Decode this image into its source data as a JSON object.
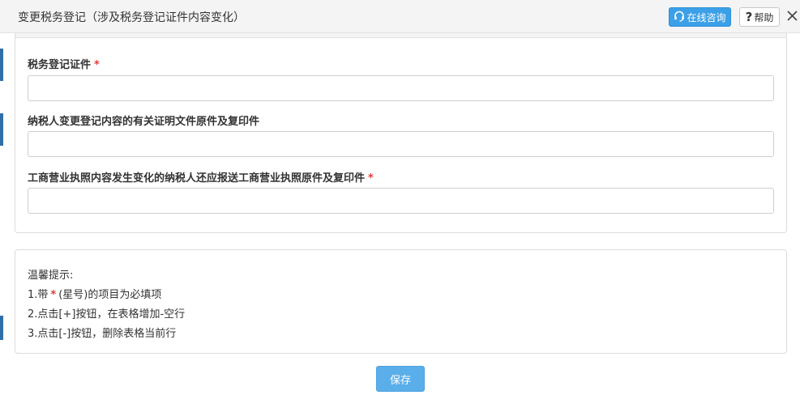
{
  "dialog": {
    "title": "变更税务登记（涉及税务登记证件内容变化）",
    "online_consult_label": "在线咨询",
    "help_label": "帮助",
    "help_glyph": "?",
    "close_glyph": "✕"
  },
  "form": {
    "fields": [
      {
        "label": "税务登记证件",
        "required": true,
        "value": ""
      },
      {
        "label": "纳税人变更登记内容的有关证明文件原件及复印件",
        "required": false,
        "value": ""
      },
      {
        "label": "工商营业执照内容发生变化的纳税人还应报送工商营业执照原件及复印件",
        "required": true,
        "value": ""
      }
    ],
    "required_mark": "*"
  },
  "tips": {
    "heading": "温馨提示:",
    "line1_prefix": "1.带",
    "line1_star": "*",
    "line1_suffix": "(星号)的项目为必填项",
    "line2": "2.点击[+]按钮，在表格增加-空行",
    "line3": "3.点击[-]按钮，删除表格当前行"
  },
  "actions": {
    "save_label": "保存"
  },
  "colors": {
    "accent": "#3ca0e8",
    "save": "#5aaeea",
    "required": "#e23a3a"
  }
}
